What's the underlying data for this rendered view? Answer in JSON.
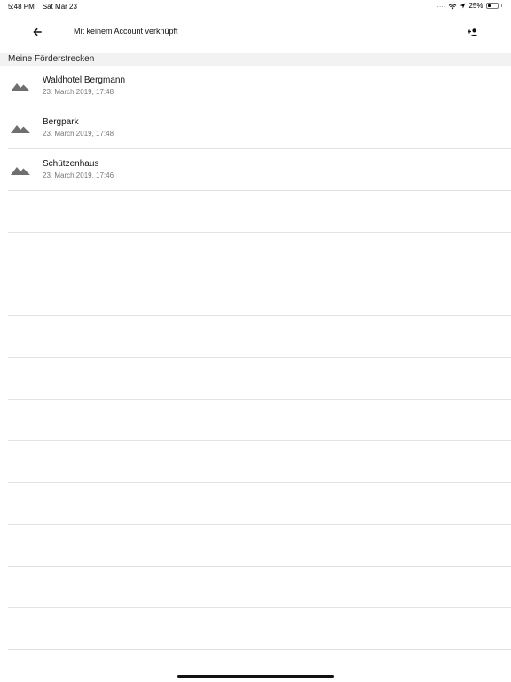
{
  "status_bar": {
    "time": "5:48 PM",
    "date": "Sat Mar 23",
    "signal": "....",
    "battery_text": "25%",
    "battery_level": 0.25
  },
  "header": {
    "back_icon": "arrow-left-icon",
    "title": "Mit keinem Account verknüpft",
    "action_icon": "person-add-icon"
  },
  "section": {
    "title": "Meine Förderstrecken"
  },
  "items": [
    {
      "icon": "mountain-icon",
      "title": "Waldhotel Bergmann",
      "subtitle": "23. March 2019, 17:48"
    },
    {
      "icon": "mountain-icon",
      "title": "Bergpark",
      "subtitle": "23. March 2019, 17:48"
    },
    {
      "icon": "mountain-icon",
      "title": "Schützenhaus",
      "subtitle": "23. March 2019, 17:46"
    }
  ],
  "colors": {
    "section_bg": "#f2f2f2",
    "divider": "#e3e3e3",
    "icon_gray": "#6f6f6f",
    "subtitle_gray": "#777777"
  }
}
